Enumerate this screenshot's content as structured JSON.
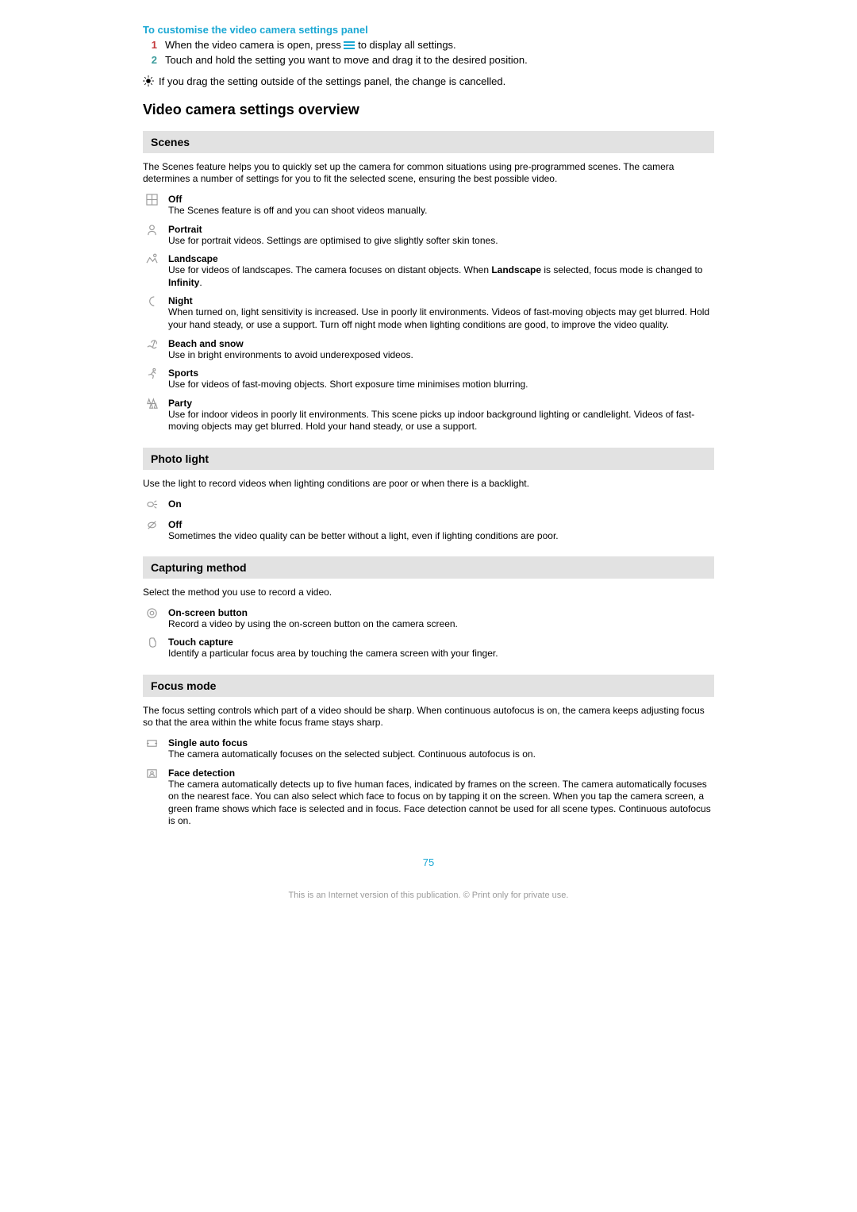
{
  "customise": {
    "heading": "To customise the video camera settings panel",
    "step1_pre": "When the video camera is open, press",
    "step1_post": "to display all settings.",
    "step2": "Touch and hold the setting you want to move and drag it to the desired position."
  },
  "tip": "If you drag the setting outside of the settings panel, the change is cancelled.",
  "overview_heading": "Video camera settings overview",
  "scenes": {
    "heading": "Scenes",
    "intro": "The Scenes feature helps you to quickly set up the camera for common situations using pre-programmed scenes. The camera determines a number of settings for you to fit the selected scene, ensuring the best possible video.",
    "items": [
      {
        "title": "Off",
        "desc": "The Scenes feature is off and you can shoot videos manually."
      },
      {
        "title": "Portrait",
        "desc": "Use for portrait videos. Settings are optimised to give slightly softer skin tones."
      },
      {
        "title": "Landscape",
        "desc_pre": "Use for videos of landscapes. The camera focuses on distant objects. When ",
        "bold": "Landscape",
        "desc_mid": " is selected, focus mode is changed to ",
        "bold2": "Infinity",
        "desc_post": "."
      },
      {
        "title": "Night",
        "desc": "When turned on, light sensitivity is increased. Use in poorly lit environments. Videos of fast-moving objects may get blurred. Hold your hand steady, or use a support. Turn off night mode when lighting conditions are good, to improve the video quality."
      },
      {
        "title": "Beach and snow",
        "desc": "Use in bright environments to avoid underexposed videos."
      },
      {
        "title": "Sports",
        "desc": "Use for videos of fast-moving objects. Short exposure time minimises motion blurring."
      },
      {
        "title": "Party",
        "desc": "Use for indoor videos in poorly lit environments. This scene picks up indoor background lighting or candlelight. Videos of fast-moving objects may get blurred. Hold your hand steady, or use a support."
      }
    ]
  },
  "photo_light": {
    "heading": "Photo light",
    "intro": "Use the light to record videos when lighting conditions are poor or when there is a backlight.",
    "items": [
      {
        "title": "On",
        "desc": ""
      },
      {
        "title": "Off",
        "desc": "Sometimes the video quality can be better without a light, even if lighting conditions are poor."
      }
    ]
  },
  "capturing": {
    "heading": "Capturing method",
    "intro": "Select the method you use to record a video.",
    "items": [
      {
        "title": "On-screen button",
        "desc": "Record a video by using the on-screen button on the camera screen."
      },
      {
        "title": "Touch capture",
        "desc": "Identify a particular focus area by touching the camera screen with your finger."
      }
    ]
  },
  "focus": {
    "heading": "Focus mode",
    "intro": "The focus setting controls which part of a video should be sharp. When continuous autofocus is on, the camera keeps adjusting focus so that the area within the white focus frame stays sharp.",
    "items": [
      {
        "title": "Single auto focus",
        "desc": "The camera automatically focuses on the selected subject. Continuous autofocus is on."
      },
      {
        "title": "Face detection",
        "desc": "The camera automatically detects up to five human faces, indicated by frames on the screen. The camera automatically focuses on the nearest face. You can also select which face to focus on by tapping it on the screen. When you tap the camera screen, a green frame shows which face is selected and in focus. Face detection cannot be used for all scene types. Continuous autofocus is on."
      }
    ]
  },
  "page_number": "75",
  "footer": "This is an Internet version of this publication. © Print only for private use."
}
